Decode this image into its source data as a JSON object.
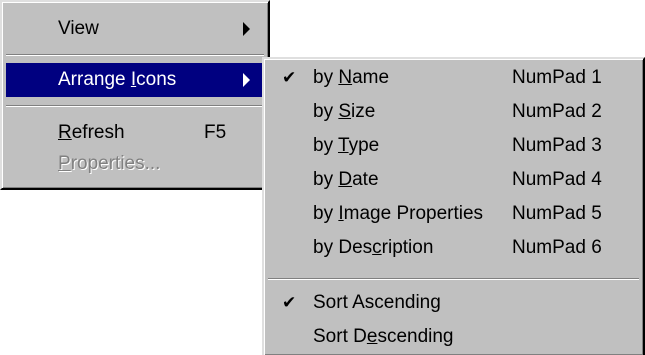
{
  "main_menu": {
    "items": [
      {
        "label": "View",
        "has_submenu": true
      },
      {
        "label_pre": "Arrange ",
        "label_u": "I",
        "label_post": "cons",
        "has_submenu": true,
        "highlighted": true
      },
      {
        "label_pre": "",
        "label_u": "R",
        "label_post": "efresh",
        "shortcut": "F5"
      },
      {
        "label_pre": "",
        "label_u": "P",
        "label_post": "roperties...",
        "disabled": true
      }
    ]
  },
  "sub_menu": {
    "items": [
      {
        "check": "✔",
        "label_pre": "by ",
        "label_u": "N",
        "label_post": "ame",
        "shortcut": "NumPad 1"
      },
      {
        "label_pre": "by ",
        "label_u": "S",
        "label_post": "ize",
        "shortcut": "NumPad 2"
      },
      {
        "label_pre": "by ",
        "label_u": "T",
        "label_post": "ype",
        "shortcut": "NumPad 3"
      },
      {
        "label_pre": "by ",
        "label_u": "D",
        "label_post": "ate",
        "shortcut": "NumPad 4"
      },
      {
        "label_pre": "by ",
        "label_u": "I",
        "label_post": "mage Properties",
        "shortcut": "NumPad 5"
      },
      {
        "label_pre": "by Des",
        "label_u": "c",
        "label_post": "ription",
        "shortcut": "NumPad 6"
      },
      {
        "check": "✔",
        "label": "Sort Ascending"
      },
      {
        "label_pre": "Sort D",
        "label_u": "e",
        "label_post": "scending"
      }
    ]
  }
}
